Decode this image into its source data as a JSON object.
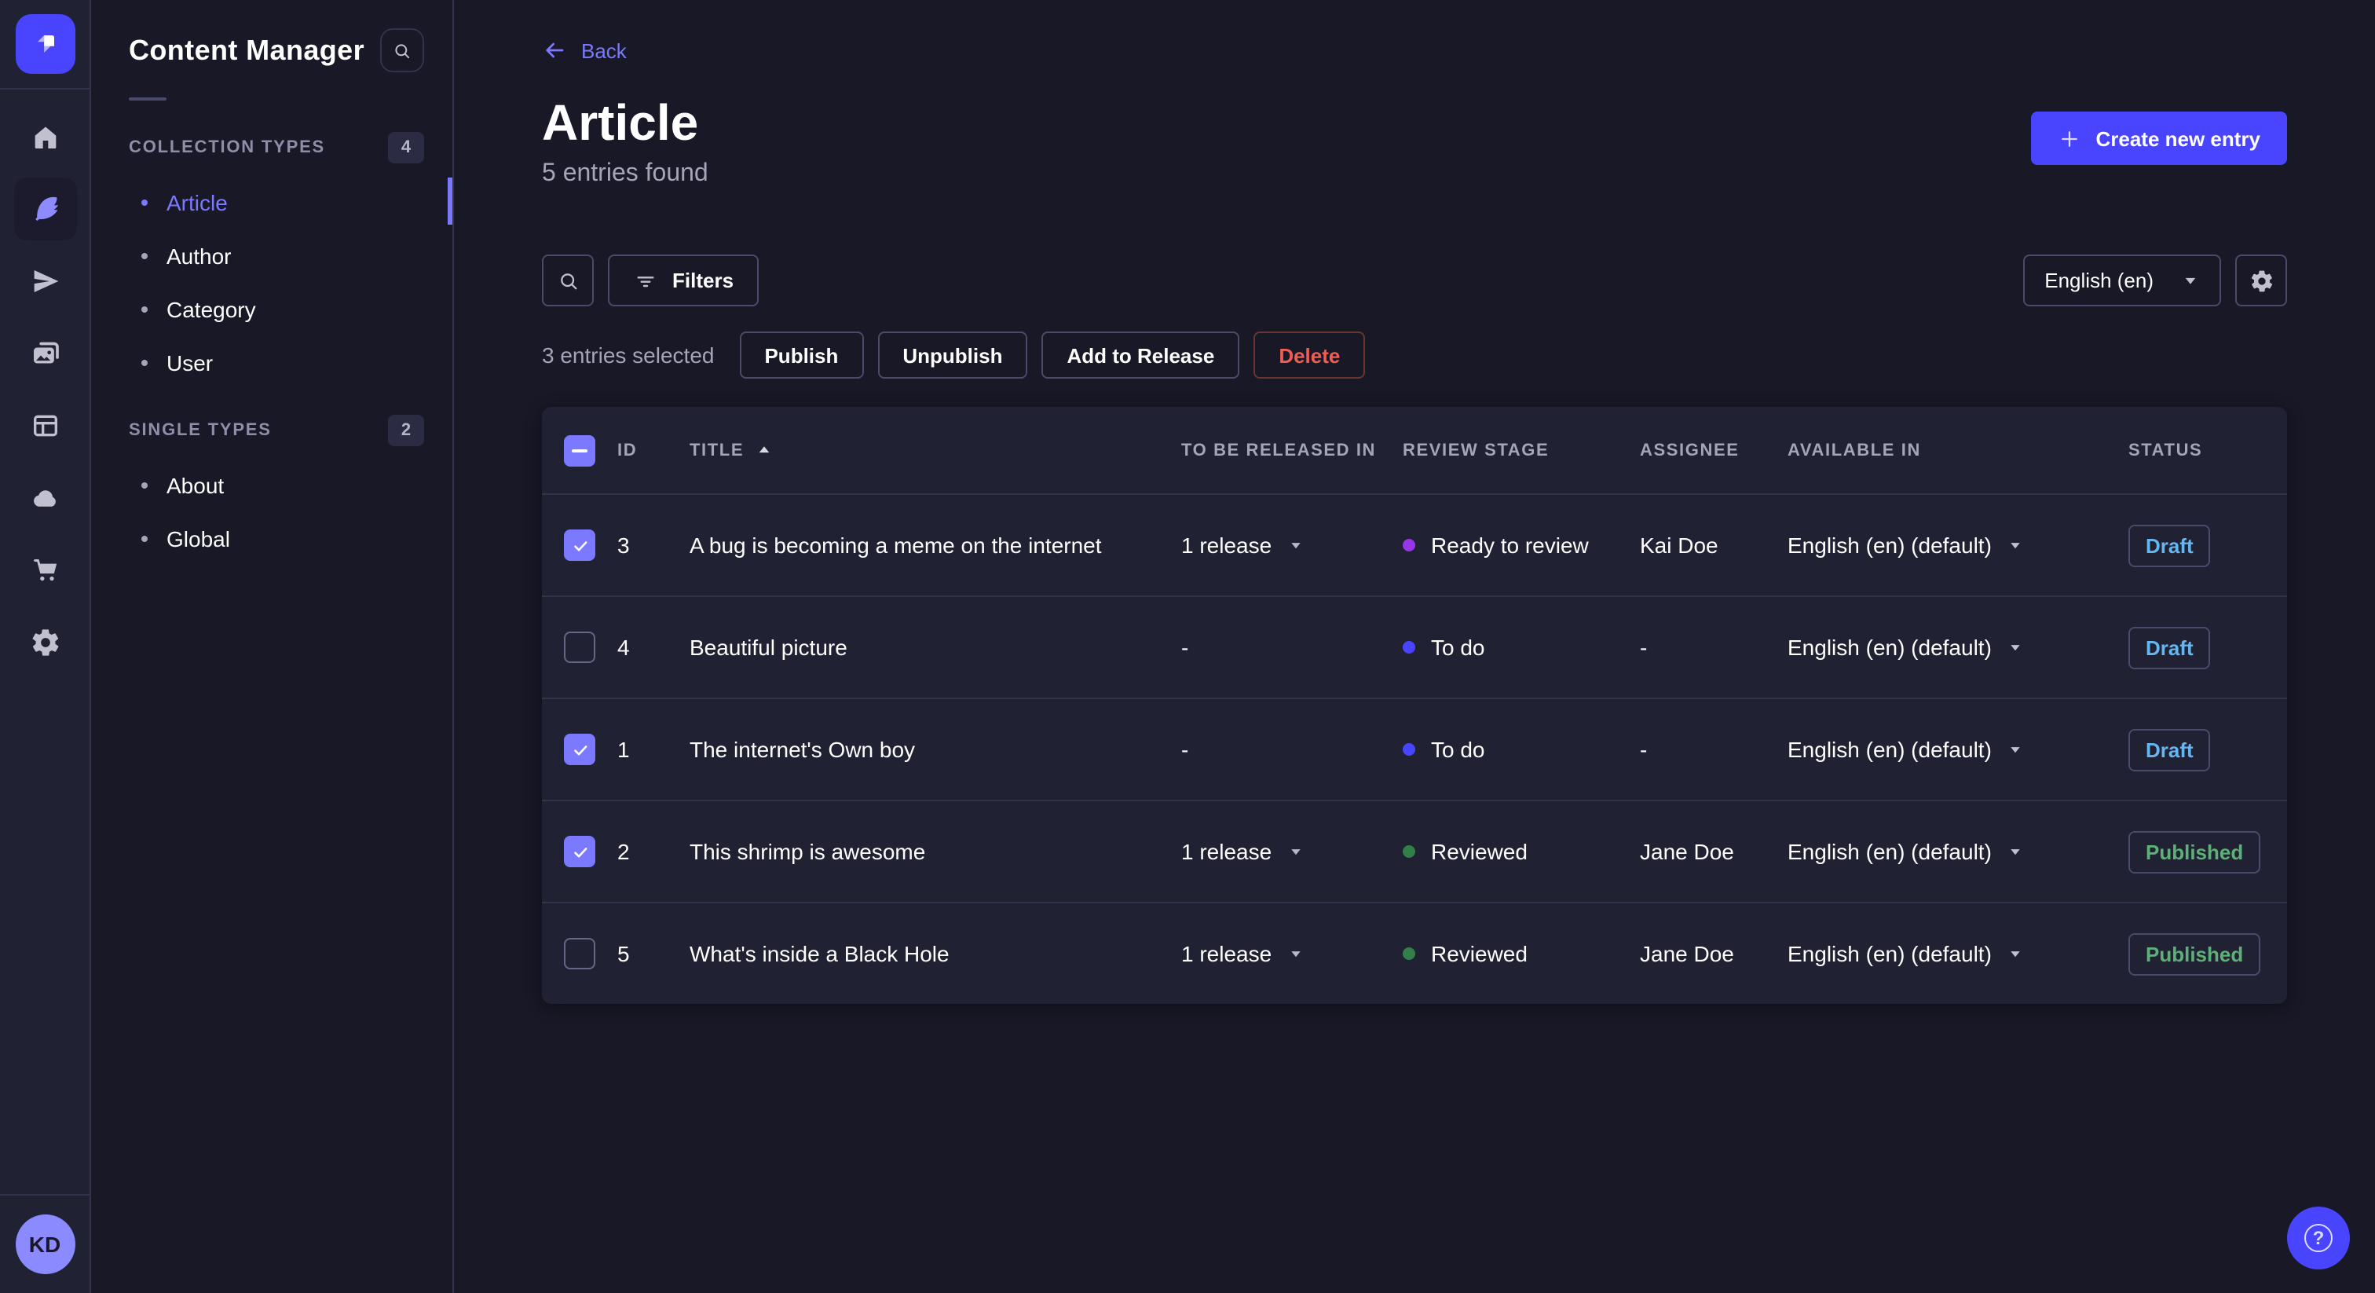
{
  "app": {
    "rail_icons": [
      "strapi-logo",
      "home",
      "feather",
      "paper-plane",
      "media-library",
      "content-type-builder",
      "cloud",
      "marketplace-cart",
      "settings-gear"
    ],
    "active_rail_icon": "feather",
    "avatar_initials": "KD",
    "help_icon": "question-mark"
  },
  "subnav": {
    "title": "Content Manager",
    "search_icon": "search",
    "sections": [
      {
        "label": "COLLECTION TYPES",
        "badge": "4",
        "items": [
          {
            "label": "Article",
            "active": true
          },
          {
            "label": "Author",
            "active": false
          },
          {
            "label": "Category",
            "active": false
          },
          {
            "label": "User",
            "active": false
          }
        ]
      },
      {
        "label": "SINGLE TYPES",
        "badge": "2",
        "items": [
          {
            "label": "About",
            "active": false
          },
          {
            "label": "Global",
            "active": false
          }
        ]
      }
    ]
  },
  "header": {
    "back_label": "Back",
    "title": "Article",
    "subtitle": "5 entries found",
    "create_button_label": "Create new entry"
  },
  "toolbar": {
    "filters_label": "Filters",
    "locale_value": "English (en)"
  },
  "selection": {
    "text": "3 entries selected",
    "buttons": [
      {
        "label": "Publish",
        "variant": "default"
      },
      {
        "label": "Unpublish",
        "variant": "default"
      },
      {
        "label": "Add to Release",
        "variant": "default"
      },
      {
        "label": "Delete",
        "variant": "danger"
      }
    ]
  },
  "table": {
    "headers": {
      "id": "ID",
      "title": "TITLE",
      "released": "TO BE RELEASED IN",
      "review": "REVIEW STAGE",
      "assignee": "ASSIGNEE",
      "available": "AVAILABLE IN",
      "status": "STATUS"
    },
    "sort_column": "TITLE",
    "sort_direction": "asc",
    "header_checkbox_state": "indeterminate",
    "rows": [
      {
        "checked": true,
        "id": "3",
        "title": "A bug is becoming a meme on the internet",
        "released": "1 release",
        "stage": "Ready to review",
        "stage_color": "#9736e8",
        "assignee": "Kai Doe",
        "available": "English (en) (default)",
        "status": "Draft"
      },
      {
        "checked": false,
        "id": "4",
        "title": "Beautiful picture",
        "released": "-",
        "stage": "To do",
        "stage_color": "#4945ff",
        "assignee": "-",
        "available": "English (en) (default)",
        "status": "Draft"
      },
      {
        "checked": true,
        "id": "1",
        "title": "The internet's Own boy",
        "released": "-",
        "stage": "To do",
        "stage_color": "#4945ff",
        "assignee": "-",
        "available": "English (en) (default)",
        "status": "Draft"
      },
      {
        "checked": true,
        "id": "2",
        "title": "This shrimp is awesome",
        "released": "1 release",
        "stage": "Reviewed",
        "stage_color": "#328048",
        "assignee": "Jane Doe",
        "available": "English (en) (default)",
        "status": "Published"
      },
      {
        "checked": false,
        "id": "5",
        "title": "What's inside a Black Hole",
        "released": "1 release",
        "stage": "Reviewed",
        "stage_color": "#328048",
        "assignee": "Jane Doe",
        "available": "English (en) (default)",
        "status": "Published"
      }
    ]
  },
  "colors": {
    "primary": "#4945ff",
    "primary_light": "#7b79ff",
    "draft": "#66b7f1",
    "published": "#5cb176",
    "danger": "#ee5e52"
  }
}
